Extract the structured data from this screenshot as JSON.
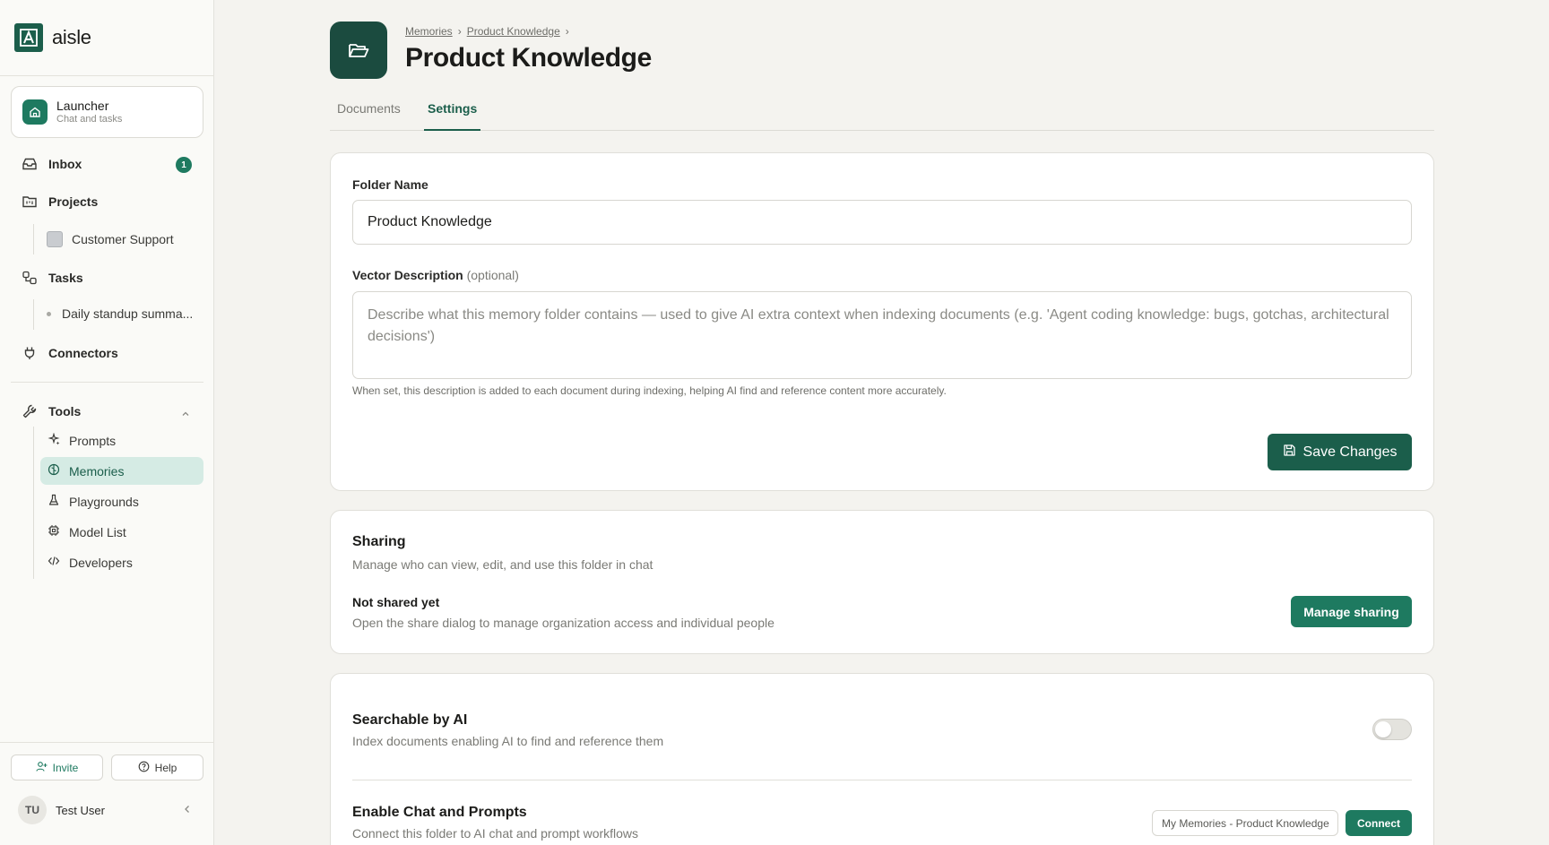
{
  "app": {
    "name": "aisle"
  },
  "sidebar": {
    "launcher": {
      "title": "Launcher",
      "subtitle": "Chat and tasks"
    },
    "inbox": {
      "label": "Inbox",
      "badge": "1"
    },
    "projects": {
      "label": "Projects",
      "items": [
        "Customer Support"
      ]
    },
    "tasks": {
      "label": "Tasks",
      "items": [
        "Daily standup summa..."
      ]
    },
    "connectors": {
      "label": "Connectors"
    },
    "tools": {
      "label": "Tools",
      "items": [
        "Prompts",
        "Memories",
        "Playgrounds",
        "Model List",
        "Developers"
      ],
      "active": "Memories"
    },
    "invite_label": "Invite",
    "help_label": "Help",
    "user": {
      "initials": "TU",
      "name": "Test User"
    }
  },
  "header": {
    "breadcrumb": [
      "Memories",
      "Product Knowledge"
    ],
    "title": "Product Knowledge"
  },
  "tabs": [
    {
      "label": "Documents",
      "active": false
    },
    {
      "label": "Settings",
      "active": true
    }
  ],
  "settings": {
    "folder_name_label": "Folder Name",
    "folder_name_value": "Product Knowledge",
    "vector_label": "Vector Description",
    "vector_optional": "(optional)",
    "vector_placeholder": "Describe what this memory folder contains — used to give AI extra context when indexing documents (e.g. 'Agent coding knowledge: bugs, gotchas, architectural decisions')",
    "vector_hint": "When set, this description is added to each document during indexing, helping AI find and reference content more accurately.",
    "save_label": "Save Changes"
  },
  "sharing": {
    "title": "Sharing",
    "subtitle": "Manage who can view, edit, and use this folder in chat",
    "status": "Not shared yet",
    "status_sub": "Open the share dialog to manage organization access and individual people",
    "button": "Manage sharing"
  },
  "ai": {
    "searchable_title": "Searchable by AI",
    "searchable_sub": "Index documents enabling AI to find and reference them",
    "searchable_enabled": false,
    "chat_title": "Enable Chat and Prompts",
    "chat_sub": "Connect this folder to AI chat and prompt workflows",
    "connector_name": "My Memories - Product Knowledge",
    "connect_label": "Connect"
  },
  "colors": {
    "accent": "#1b5e4b",
    "accent_light": "#d5ebe4",
    "background": "#f4f3ef"
  }
}
